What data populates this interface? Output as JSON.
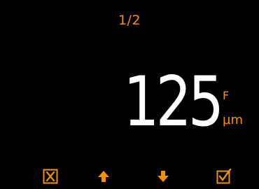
{
  "screen": {
    "page_indicator": "1/2",
    "reading": {
      "value": "125",
      "probe_type": "F",
      "unit": "µm"
    }
  },
  "softkeys": [
    {
      "icon": "close-icon"
    },
    {
      "icon": "arrow-up-icon"
    },
    {
      "icon": "arrow-down-icon"
    },
    {
      "icon": "checkbox-check-icon"
    }
  ],
  "colors": {
    "background": "#000000",
    "accent": "#f39200",
    "reading": "#ffffff"
  }
}
